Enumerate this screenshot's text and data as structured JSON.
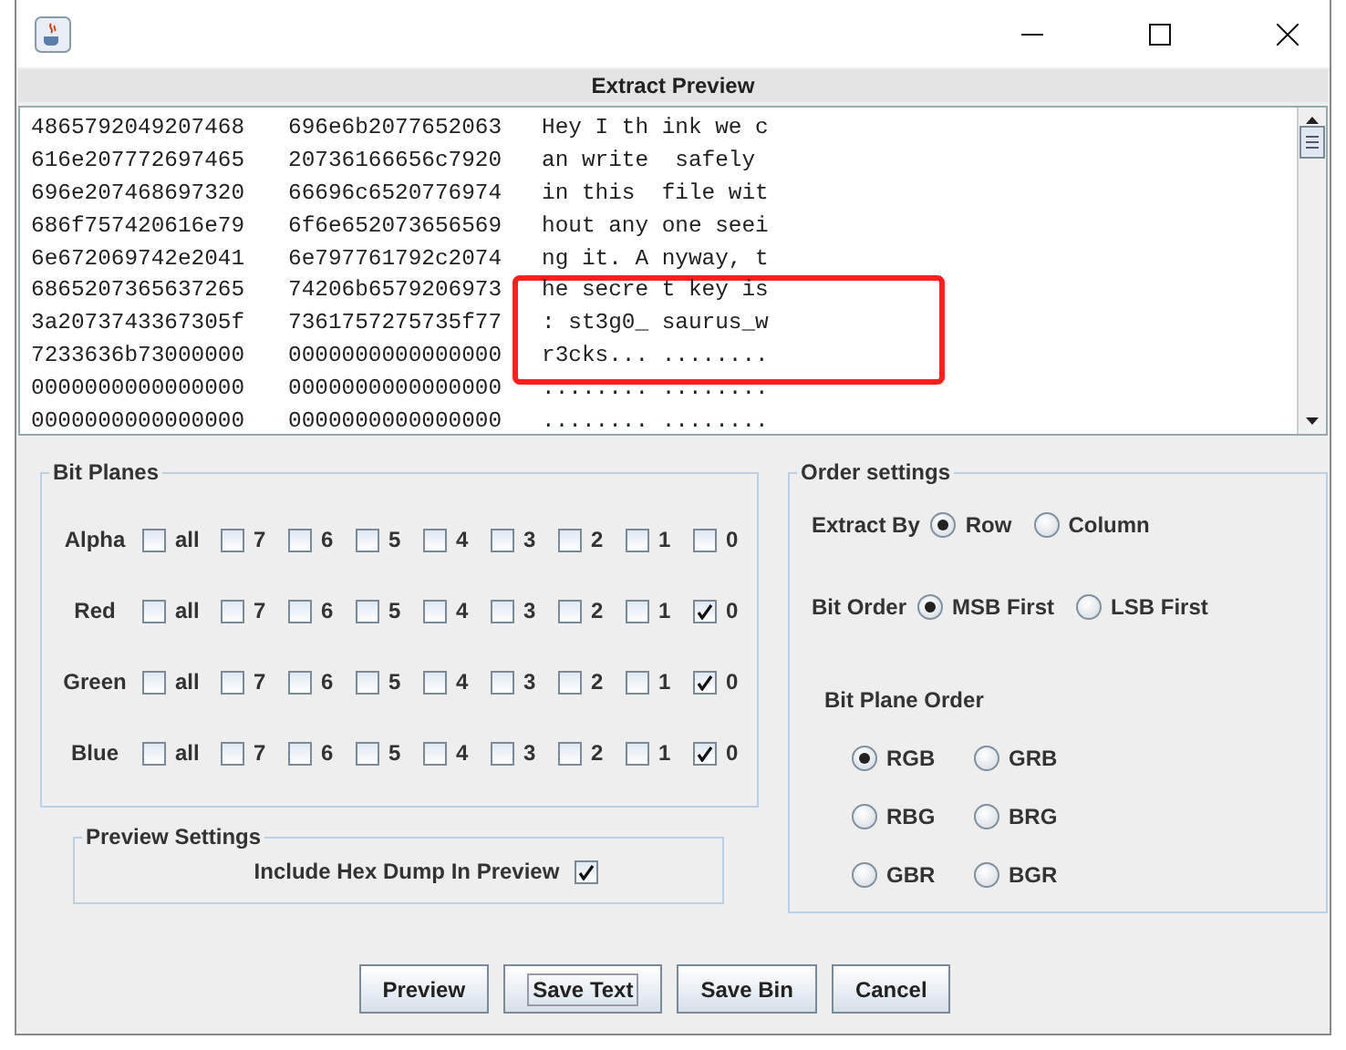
{
  "window": {
    "panel_title": "Extract Preview"
  },
  "preview": {
    "rows": [
      {
        "hex_1": "4865792049207468",
        "hex_2": "696e6b2077652063",
        "text": "Hey I th ink we c"
      },
      {
        "hex_1": "616e207772697465",
        "hex_2": "20736166656c7920",
        "text": "an write  safely"
      },
      {
        "hex_1": "696e207468697320",
        "hex_2": "66696c6520776974",
        "text": "in this  file wit"
      },
      {
        "hex_1": "686f757420616e79",
        "hex_2": "6f6e652073656569",
        "text": "hout any one seei"
      },
      {
        "hex_1": "6e672069742e2041",
        "hex_2": "6e797761792c2074",
        "text": "ng it. A nyway, t"
      },
      {
        "hex_1": "6865207365637265",
        "hex_2": "74206b6579206973",
        "text": "he secre t key is"
      },
      {
        "hex_1": "3a2073743367305f",
        "hex_2": "7361757275735f77",
        "text": ": st3g0_ saurus_w"
      },
      {
        "hex_1": "7233636b73000000",
        "hex_2": "0000000000000000",
        "text": "r3cks... ........"
      },
      {
        "hex_1": "0000000000000000",
        "hex_2": "0000000000000000",
        "text": "........ ........"
      },
      {
        "hex_1": "0000000000000000",
        "hex_2": "0000000000000000",
        "text": "........ ........"
      }
    ]
  },
  "bit_planes": {
    "title": "Bit Planes",
    "rows": [
      {
        "label": "Alpha",
        "bits": [
          {
            "label": "all",
            "checked": false
          },
          {
            "label": "7",
            "checked": false
          },
          {
            "label": "6",
            "checked": false
          },
          {
            "label": "5",
            "checked": false
          },
          {
            "label": "4",
            "checked": false
          },
          {
            "label": "3",
            "checked": false
          },
          {
            "label": "2",
            "checked": false
          },
          {
            "label": "1",
            "checked": false
          },
          {
            "label": "0",
            "checked": false
          }
        ]
      },
      {
        "label": "Red",
        "bits": [
          {
            "label": "all",
            "checked": false
          },
          {
            "label": "7",
            "checked": false
          },
          {
            "label": "6",
            "checked": false
          },
          {
            "label": "5",
            "checked": false
          },
          {
            "label": "4",
            "checked": false
          },
          {
            "label": "3",
            "checked": false
          },
          {
            "label": "2",
            "checked": false
          },
          {
            "label": "1",
            "checked": false
          },
          {
            "label": "0",
            "checked": true
          }
        ]
      },
      {
        "label": "Green",
        "bits": [
          {
            "label": "all",
            "checked": false
          },
          {
            "label": "7",
            "checked": false
          },
          {
            "label": "6",
            "checked": false
          },
          {
            "label": "5",
            "checked": false
          },
          {
            "label": "4",
            "checked": false
          },
          {
            "label": "3",
            "checked": false
          },
          {
            "label": "2",
            "checked": false
          },
          {
            "label": "1",
            "checked": false
          },
          {
            "label": "0",
            "checked": true
          }
        ]
      },
      {
        "label": "Blue",
        "bits": [
          {
            "label": "all",
            "checked": false
          },
          {
            "label": "7",
            "checked": false
          },
          {
            "label": "6",
            "checked": false
          },
          {
            "label": "5",
            "checked": false
          },
          {
            "label": "4",
            "checked": false
          },
          {
            "label": "3",
            "checked": false
          },
          {
            "label": "2",
            "checked": false
          },
          {
            "label": "1",
            "checked": false
          },
          {
            "label": "0",
            "checked": true
          }
        ]
      }
    ]
  },
  "preview_settings": {
    "title": "Preview Settings",
    "label": "Include Hex Dump In Preview",
    "checked": true
  },
  "order_settings": {
    "title": "Order settings",
    "extract_by": {
      "label": "Extract By",
      "options": [
        {
          "label": "Row",
          "selected": true
        },
        {
          "label": "Column",
          "selected": false
        }
      ]
    },
    "bit_order": {
      "label": "Bit Order",
      "options": [
        {
          "label": "MSB First",
          "selected": true
        },
        {
          "label": "LSB First",
          "selected": false
        }
      ]
    },
    "bit_plane_order": {
      "label": "Bit Plane Order",
      "options": [
        {
          "label": "RGB",
          "selected": true
        },
        {
          "label": "GRB",
          "selected": false
        },
        {
          "label": "RBG",
          "selected": false
        },
        {
          "label": "BRG",
          "selected": false
        },
        {
          "label": "GBR",
          "selected": false
        },
        {
          "label": "BGR",
          "selected": false
        }
      ]
    }
  },
  "buttons": [
    {
      "label": "Preview",
      "focused": false
    },
    {
      "label": "Save Text",
      "focused": true
    },
    {
      "label": "Save Bin",
      "focused": false
    },
    {
      "label": "Cancel",
      "focused": false
    }
  ]
}
